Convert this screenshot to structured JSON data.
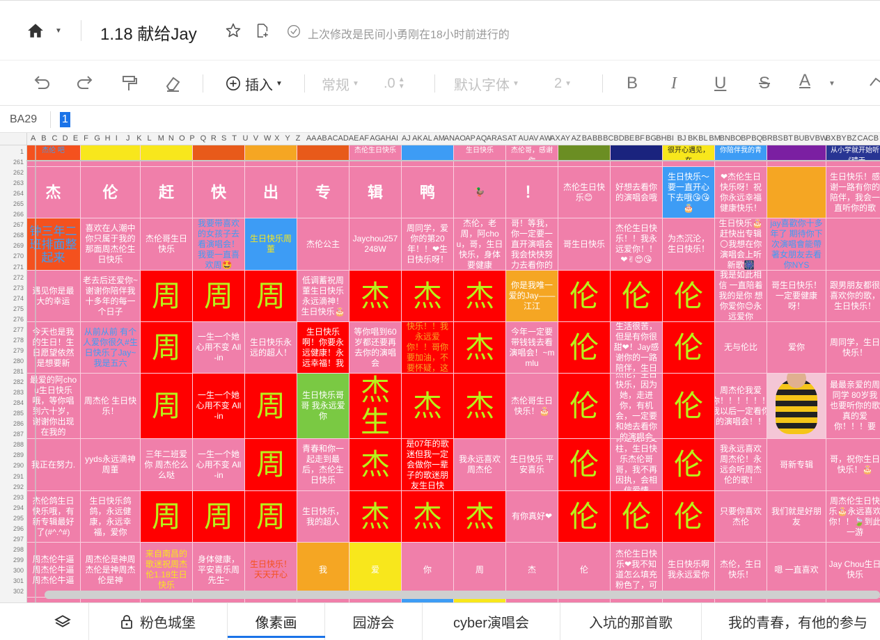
{
  "header": {
    "title": "1.18 献给Jay",
    "last_modified": "上次修改是民间小勇刚在18小时前进行的"
  },
  "toolbar": {
    "insert_label": "插入",
    "format_label": "常规",
    "decimal_label": ".0",
    "font_label": "默认字体",
    "size_label": "2",
    "bold_label": "B",
    "italic_label": "I",
    "underline_label": "U",
    "strike_label": "S",
    "color_label": "A"
  },
  "formula_bar": {
    "cell_ref": "BA29",
    "value": "1"
  },
  "columns": [
    "A",
    "B",
    "C",
    "D",
    "E",
    "F",
    "G",
    "H",
    "I",
    "J",
    "K",
    "L",
    "M",
    "N",
    "O",
    "P",
    "Q",
    "R",
    "S",
    "T",
    "U",
    "V",
    "W",
    "X",
    "Y",
    "Z",
    "AA",
    "AB",
    "AC",
    "AD",
    "AE",
    "AF",
    "AG",
    "AH",
    "AI",
    "AJ",
    "AK",
    "AL",
    "AM",
    "AN",
    "AO",
    "AP",
    "AQ",
    "AR",
    "AS",
    "AT",
    "AU",
    "AV",
    "AW",
    "AX",
    "AY",
    "AZ",
    "BA",
    "BB",
    "BC",
    "BD",
    "BE",
    "BF",
    "BG",
    "BH",
    "BI",
    "BJ",
    "BK",
    "BL",
    "BM",
    "BN",
    "BO",
    "BP",
    "BQ",
    "BR",
    "BS",
    "BT",
    "BU",
    "BV",
    "BW",
    "BX",
    "BY",
    "BZ",
    "CA",
    "CB"
  ],
  "rows": [
    "1",
    "261",
    "262",
    "263",
    "264",
    "265",
    "266",
    "267",
    "268",
    "269",
    "270",
    "271",
    "272",
    "273",
    "274",
    "275",
    "276",
    "277",
    "278",
    "279",
    "280",
    "281",
    "282",
    "283",
    "284",
    "285",
    "286",
    "287",
    "288",
    "289",
    "290",
    "291",
    "292",
    "293",
    "294",
    "295",
    "296",
    "297",
    "298",
    "299",
    "300",
    "301",
    "302"
  ],
  "grid": {
    "top_row": [
      "杰伦 吧",
      "",
      "",
      "",
      "",
      "",
      "杰伦生日快乐",
      "",
      "生日快乐",
      "杰伦哥，感谢你",
      "",
      "",
      "很开心遇见，在",
      "你陪伴我的青",
      "",
      "从小学就开始听《晴天",
      "杰伦 我是香"
    ],
    "rows": [
      [
        "杰",
        "伦",
        "赶",
        "快",
        "出",
        "专",
        "辑",
        "鸭",
        "🦆",
        "！",
        "杰伦生日快乐😊",
        "好想去看你的演唱会哦",
        "生日快乐～要一直开心下去哦😘😘🎂",
        "❤杰伦生日快乐呀！祝你永远幸福健康快乐！",
        "",
        "生日快乐！感谢一路有你的陪伴，我会一直听你的歌"
      ],
      [
        "钟三年二班排面整起来",
        "喜欢在人潮中你只属于我的那面周杰伦生日快乐",
        "杰伦哥生日快乐",
        "我要带喜欢的女孩子去看演唱会！我要一直喜欢周🤩",
        "生日快乐周董",
        "杰伦公主",
        "Jaychou257248W",
        "周同学，爱你的第20年！！❤生日快乐呀！",
        "杰伦，老周，阿chou，哥，生日快乐，身体要健康",
        "哥！等我，你一定要一直开演唱会我会快快努力去看你的",
        "哥生日快乐",
        "杰伦生日快乐！！我永远爱你！！❤✌😍😘",
        "为杰沉沦，生日快乐！",
        "生日快乐🎂赶快出专辑🌕我想在你演唱会上听新歌🎆",
        "jay喜歡你十多年了 期待你下次演唱會能帶著女朋友去看你NYS",
        ""
      ],
      [
        "遇见你是最大的幸运",
        "老去后还爱你~谢谢你陪伴我十多年的每一个日子",
        "周",
        "周",
        "周",
        "低调蓄祝周董生日快乐永远滴神！生日快乐🎂",
        "杰",
        "杰",
        "杰",
        "你是我唯一爱的Jay——江江",
        "伦",
        "伦",
        "伦",
        "我是如此相信 一直陪着我的是你 想你爱你😊永远爱你",
        "哥生日快乐！一定要健康呀！",
        "跟男朋友都很喜欢你的歌，生日快乐！"
      ],
      [
        "今天也是我的生日！生日愿望依然是想要新",
        "从前从前 有个人爱你很久#生日快乐了Jay~我是五六",
        "周",
        "一生一个她心用不变 All-in",
        "生日快乐永远的超人！",
        "生日快乐啊！你要永远健康！永远幸福！我",
        "等你唱到60岁都还要再去你的演唱会",
        "周chou生日快乐！！我永远爱你！！哥你要加油，不要怀疑，这个",
        "杰",
        "今年一定要带钱钱去看演唱会！~mmlu",
        "伦",
        "生活很苦，但是有你很甜❤！Jay感谢你的一路陪伴，生日",
        "伦",
        "无与伦比",
        "爱你",
        "周同学，生日快乐！"
      ],
      [
        "最爱的阿chou生日快乐哦，等你唱到六十岁，谢谢你出现在我的",
        "周杰伦 生日快乐！",
        "周",
        "一生一个她心用不变 All-in",
        "周",
        "生日快乐哥哥 我永远爱你",
        "杰生",
        "杰",
        "杰",
        "杰伦哥生日快乐！🎂",
        "伦",
        "杰伦，生日快乐，因为她，走进你，有机会，一定要和她去看你的演唱会",
        "伦",
        "周杰伦我爱你！！！！！！我以后一定看你的演唱会！！",
        "[photo]",
        "最最亲爱的周同学 80岁我也要听你的歌 真的爱你！！！要"
      ],
      [
        "我正在努力.",
        "yyds永远滴神周董",
        "三年二班爱你 周杰伦么么哒",
        "一生一个她心用不变 All-in",
        "周",
        "青春和你一起走到最后，杰伦生日快乐",
        "杰",
        "哥，虽然我是07年的歌迷但我一定会做你一辈子的歌迷朋友生日快乐！",
        "我永远喜欢周杰伦",
        "生日快乐 平安喜乐",
        "伦",
        "你是我的支柱，生日快乐杰伦哥哥，我不再因执，会相信爱情",
        "伦",
        "我永远喜欢周杰伦！永远会听周杰伦的歌！",
        "哥新专辑",
        "哥，祝你生日快乐！🎂"
      ],
      [
        "杰伦鸽生日快乐哦，有新专辑最好了(#^.^#)",
        "生日快乐鸽鸽，永远健康，永远幸福，爱你",
        "周",
        "周",
        "周",
        "生日快乐，我的超人",
        "杰",
        "杰",
        "杰",
        "有你真好❤",
        "伦",
        "伦",
        "伦",
        "只要你喜欢杰伦",
        "我们就是好朋友",
        "周杰伦生日快乐🎂永远喜欢你！！🍃到此一游"
      ],
      [
        "周杰伦牛逼周杰伦牛逼周杰伦牛逼",
        "周杰伦是神周杰伦是神周杰伦是神",
        "来自南昌的歌迷祝周杰伦1.18生日快乐",
        "身体健康，平安喜乐周先生~",
        "生日快乐！天天开心",
        "我",
        "爱",
        "你",
        "周",
        "杰",
        "伦",
        "杰伦生日快乐❤我不知道怎么填充粉色了，可",
        "生日快乐啊我永远爱你",
        "杰伦，生日快乐！",
        "嗯 一直喜欢",
        "Jay Chou生日快乐"
      ]
    ]
  },
  "sheets": [
    "粉色城堡",
    "像素画",
    "园游会",
    "cyber演唱会",
    "入坑的那首歌",
    "我的青春，有他的参与"
  ],
  "active_sheet": "像素画",
  "colors": {
    "pink": "#f07faa",
    "red": "#ff0000",
    "green_text": "#b8f21a",
    "orange_red": "#f4511e",
    "blue": "#3d9cf5",
    "green": "#7ac943",
    "orange": "#f5a623",
    "yellow": "#f8e71c",
    "accent": "#1a73e8"
  }
}
